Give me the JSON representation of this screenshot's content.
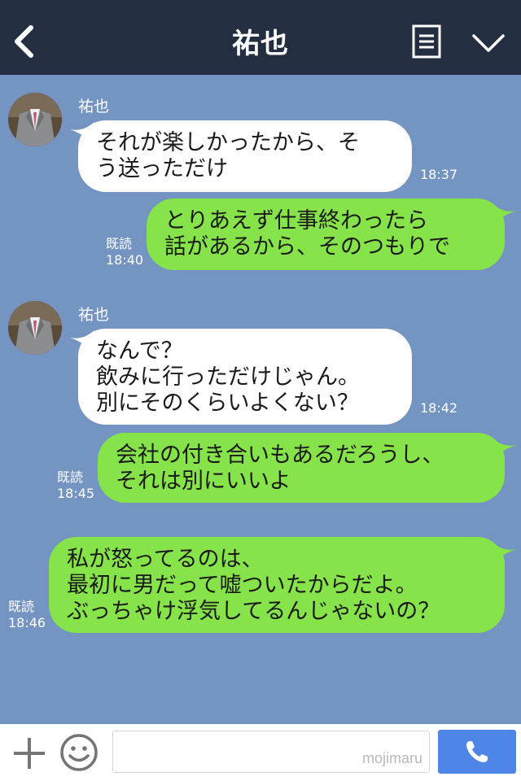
{
  "header": {
    "title": "祐也"
  },
  "contact": {
    "name": "祐也"
  },
  "messages": [
    {
      "side": "in",
      "lines": [
        "それが楽しかったから、そ",
        "う送っただけ"
      ],
      "time": "18:37"
    },
    {
      "side": "out",
      "lines": [
        "とりあえず仕事終わったら",
        "話があるから、そのつもりで"
      ],
      "read": "既読",
      "time": "18:40"
    },
    {
      "side": "in",
      "lines": [
        "なんで？",
        "飲みに行っただけじゃん。",
        "別にそのくらいよくない？"
      ],
      "time": "18:42"
    },
    {
      "side": "out",
      "lines": [
        "会社の付き合いもあるだろうし、",
        "それは別にいいよ"
      ],
      "read": "既読",
      "time": "18:45"
    },
    {
      "side": "out",
      "lines": [
        "私が怒ってるのは、",
        "最初に男だって嘘ついたからだよ。",
        "ぶっちゃけ浮気してるんじゃないの？"
      ],
      "read": "既読",
      "time": "18:46"
    }
  ],
  "footer": {
    "watermark": "mojimaru"
  },
  "icons": {
    "back": "chevron-left-icon",
    "menu": "notes-icon",
    "collapse": "chevron-down-icon",
    "add": "plus-icon",
    "sticker": "smiley-icon",
    "call": "phone-icon"
  },
  "colors": {
    "header_bg": "#242e41",
    "chat_bg": "#7494c2",
    "incoming_bubble": "#ffffff",
    "outgoing_bubble": "#86e34a",
    "call_button": "#4e86e8"
  }
}
